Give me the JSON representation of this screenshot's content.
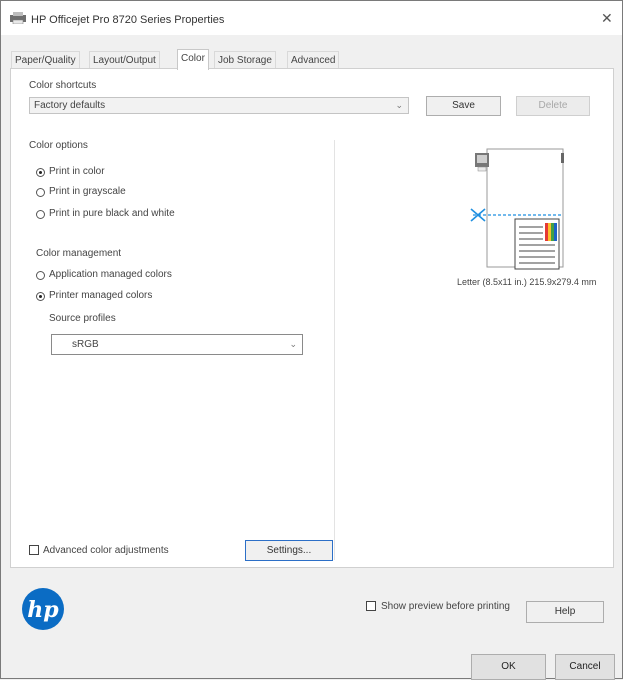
{
  "window": {
    "title": "HP Officejet Pro 8720 Series Properties",
    "close_glyph": "✕"
  },
  "tabs": [
    {
      "label": "Paper/Quality"
    },
    {
      "label": "Layout/Output"
    },
    {
      "label": "Color"
    },
    {
      "label": "Job Storage"
    },
    {
      "label": "Advanced"
    }
  ],
  "shortcuts": {
    "label": "Color shortcuts",
    "value": "Factory defaults",
    "save_label": "Save",
    "delete_label": "Delete"
  },
  "color_options": {
    "label": "Color options",
    "options": [
      {
        "label": "Print in color",
        "selected": true
      },
      {
        "label": "Print in grayscale",
        "selected": false
      },
      {
        "label": "Print in pure black and white",
        "selected": false
      }
    ]
  },
  "color_management": {
    "label": "Color management",
    "options": [
      {
        "label": "Application managed colors",
        "selected": false
      },
      {
        "label": "Printer managed colors",
        "selected": true
      }
    ],
    "source_profiles_label": "Source profiles",
    "source_profile_value": "sRGB"
  },
  "preview": {
    "caption": "Letter (8.5x11 in.) 215.9x279.4 mm"
  },
  "advanced": {
    "checkbox_label": "Advanced color adjustments",
    "settings_label": "Settings..."
  },
  "footer": {
    "show_preview_label": "Show preview before printing",
    "help_label": "Help",
    "ok_label": "OK",
    "cancel_label": "Cancel"
  },
  "colors": {
    "hp_blue": "#0b6cc4",
    "cut_line": "#1f8fe0",
    "accent": "#2c6fc7"
  },
  "icons": {
    "app": "printer-icon",
    "logo": "hp-logo",
    "close": "close-icon"
  }
}
